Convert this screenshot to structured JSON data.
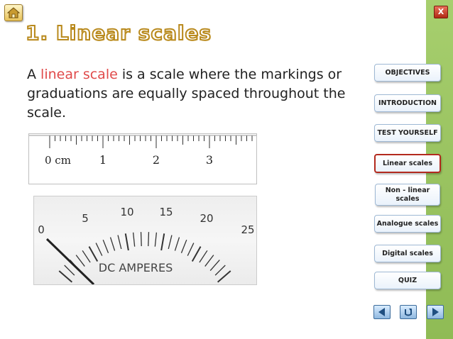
{
  "title": "1. Linear scales",
  "description": {
    "prefix": "A ",
    "highlight": "linear scale",
    "suffix": " is a scale where the markings or graduations are equally spaced throughout the scale."
  },
  "ruler": {
    "unit_label": "0 cm",
    "labels": [
      "1",
      "2",
      "3"
    ]
  },
  "meter": {
    "labels": [
      "0",
      "5",
      "10",
      "15",
      "20",
      "25"
    ],
    "caption": "DC AMPERES"
  },
  "nav": {
    "items": [
      {
        "label": "OBJECTIVES"
      },
      {
        "label": "INTRODUCTION"
      },
      {
        "label": "TEST YOURSELF"
      },
      {
        "label": "Linear scales"
      },
      {
        "label": "Non - linear scales"
      },
      {
        "label": "Analogue scales"
      },
      {
        "label": "Digital scales"
      },
      {
        "label": "QUIZ"
      }
    ],
    "active_index": 3
  },
  "close_label": "X",
  "colors": {
    "highlight": "#e04a4a",
    "panel": "#9cc563",
    "active_border": "#b32a1e",
    "title_stroke": "#b98a1e"
  }
}
